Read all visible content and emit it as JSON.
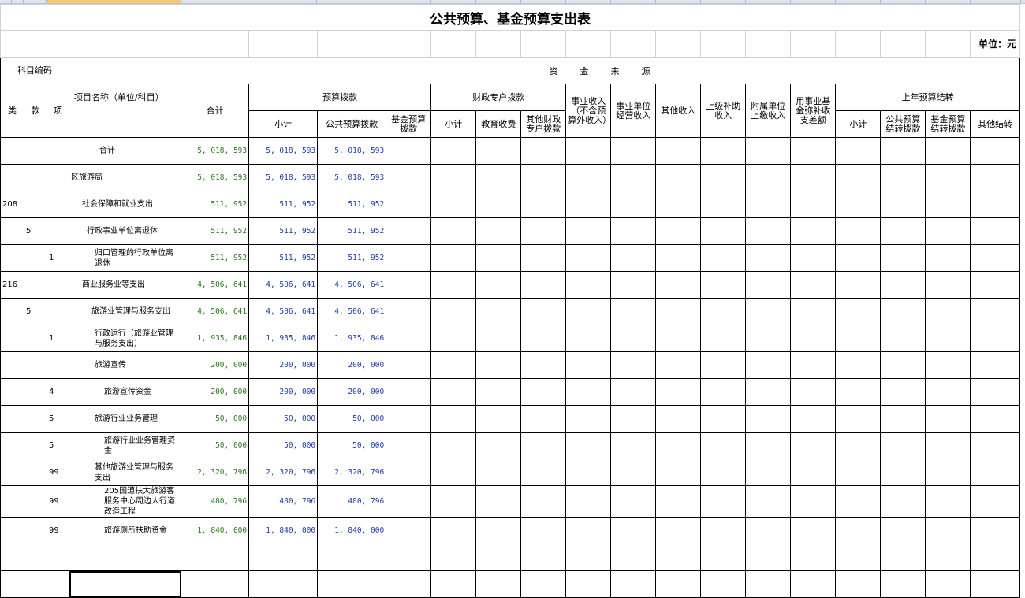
{
  "title": "公共预算、基金预算支出表",
  "unit": "单位：元",
  "headers": {
    "subject_code": "科目编码",
    "project_name": "项目名称（单位/科目）",
    "total": "合计",
    "fund_source": "资　　金　　来　　源",
    "budget_alloc": "预算拨款",
    "fiscal_special": "财政专户拨款",
    "business_income": "事业收入（不含预算外收入）",
    "business_operating": "事业单位经营收入",
    "other_income": "其他收入",
    "superior_subsidy": "上级补助收入",
    "affiliated_income": "附属单位上缴收入",
    "fund_diff": "用事业基金弥补收支差额",
    "last_year_carry": "上年预算结转",
    "lei": "类",
    "kuan": "款",
    "xiang": "项",
    "subtotal": "小计",
    "public_budget": "公共预算拨款",
    "fund_budget": "基金预算拨款",
    "edu_fee": "教育收费",
    "other_fiscal": "其他财政专户拨款",
    "public_carry": "公共预算结转拨款",
    "fund_carry": "基金预算结转拨款",
    "other_carry": "其他结转"
  },
  "rows": [
    {
      "lei": "",
      "kuan": "",
      "xiang": "",
      "name": "合计",
      "indent": 36,
      "total": "5, 018, 593",
      "sub": "5, 018, 593",
      "pub": "5, 018, 593"
    },
    {
      "lei": "",
      "kuan": "",
      "xiang": "",
      "name": "区旅游局",
      "indent": 0,
      "total": "5, 018, 593",
      "sub": "5, 018, 593",
      "pub": "5, 018, 593"
    },
    {
      "lei": "208",
      "kuan": "",
      "xiang": "",
      "name": "社会保障和就业支出",
      "indent": 14,
      "total": "511, 952",
      "sub": "511, 952",
      "pub": "511, 952"
    },
    {
      "lei": "",
      "kuan": "5",
      "xiang": "",
      "name": "行政事业单位离退休",
      "indent": 20,
      "total": "511, 952",
      "sub": "511, 952",
      "pub": "511, 952"
    },
    {
      "lei": "",
      "kuan": "",
      "xiang": "1",
      "name": "归口管理的行政单位离退休",
      "indent": 30,
      "total": "511, 952",
      "sub": "511, 952",
      "pub": "511, 952"
    },
    {
      "lei": "216",
      "kuan": "",
      "xiang": "",
      "name": "商业服务业等支出",
      "indent": 14,
      "total": "4, 506, 641",
      "sub": "4, 506, 641",
      "pub": "4, 506, 641"
    },
    {
      "lei": "",
      "kuan": "5",
      "xiang": "",
      "name": "旅游业管理与服务支出",
      "indent": 26,
      "total": "4, 506, 641",
      "sub": "4, 506, 641",
      "pub": "4, 506, 641"
    },
    {
      "lei": "",
      "kuan": "",
      "xiang": "1",
      "name": "行政运行（旅游业管理与服务支出）",
      "indent": 30,
      "total": "1, 935, 846",
      "sub": "1, 935, 846",
      "pub": "1, 935, 846"
    },
    {
      "lei": "",
      "kuan": "",
      "xiang": "",
      "name": "旅游宣传",
      "indent": 30,
      "total": "200, 000",
      "sub": "200, 000",
      "pub": "200, 000"
    },
    {
      "lei": "",
      "kuan": "",
      "xiang": "4",
      "name": "旅游宣传资金",
      "indent": 42,
      "total": "200, 000",
      "sub": "200, 000",
      "pub": "200, 000"
    },
    {
      "lei": "",
      "kuan": "",
      "xiang": "5",
      "name": "旅游行业业务管理",
      "indent": 30,
      "total": "50, 000",
      "sub": "50, 000",
      "pub": "50, 000"
    },
    {
      "lei": "",
      "kuan": "",
      "xiang": "5",
      "name": "旅游行业业务管理资金",
      "indent": 42,
      "total": "50, 000",
      "sub": "50, 000",
      "pub": "50, 000"
    },
    {
      "lei": "",
      "kuan": "",
      "xiang": "99",
      "name": "其他旅游业管理与服务支出",
      "indent": 30,
      "total": "2, 320, 796",
      "sub": "2, 320, 796",
      "pub": "2, 320, 796"
    },
    {
      "lei": "",
      "kuan": "",
      "xiang": "99",
      "name": "205国道扶大旅游客服务中心周边人行道改造工程",
      "indent": 42,
      "total": "480, 796",
      "sub": "480, 796",
      "pub": "480, 796"
    },
    {
      "lei": "",
      "kuan": "",
      "xiang": "99",
      "name": "旅游厕所扶助资金",
      "indent": 42,
      "total": "1, 840, 000",
      "sub": "1, 840, 000",
      "pub": "1, 840, 000"
    }
  ]
}
